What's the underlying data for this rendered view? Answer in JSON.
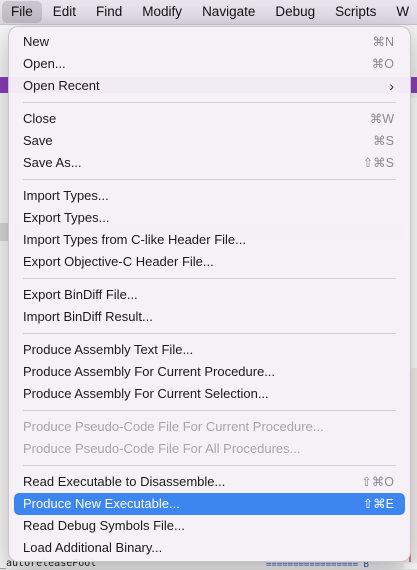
{
  "menubar": {
    "items": [
      "File",
      "Edit",
      "Find",
      "Modify",
      "Navigate",
      "Debug",
      "Scripts",
      "W"
    ]
  },
  "file_menu": {
    "groups": [
      [
        {
          "label": "New",
          "shortcut": "⌘N"
        },
        {
          "label": "Open...",
          "shortcut": "⌘O"
        },
        {
          "label": "Open Recent",
          "shortcut": "›"
        }
      ],
      [
        {
          "label": "Close",
          "shortcut": "⌘W"
        },
        {
          "label": "Save",
          "shortcut": "⌘S"
        },
        {
          "label": "Save As...",
          "shortcut": "⇧⌘S"
        }
      ],
      [
        {
          "label": "Import Types..."
        },
        {
          "label": "Export Types..."
        },
        {
          "label": "Import Types from C-like Header File..."
        },
        {
          "label": "Export Objective-C Header File..."
        }
      ],
      [
        {
          "label": "Export BinDiff File..."
        },
        {
          "label": "Import BinDiff Result..."
        }
      ],
      [
        {
          "label": "Produce Assembly Text File..."
        },
        {
          "label": "Produce Assembly For Current Procedure..."
        },
        {
          "label": "Produce Assembly For Current Selection..."
        }
      ],
      [
        {
          "label": "Produce Pseudo-Code File For Current Procedure...",
          "disabled": true
        },
        {
          "label": "Produce Pseudo-Code File For All Procedures...",
          "disabled": true
        }
      ],
      [
        {
          "label": "Read Executable to Disassemble...",
          "shortcut": "⇧⌘O"
        },
        {
          "label": "Produce New Executable...",
          "shortcut": "⇧⌘E",
          "highlight": true
        },
        {
          "label": "Read Debug Symbols File..."
        },
        {
          "label": "Load Additional Binary..."
        }
      ]
    ]
  },
  "background": {
    "bottom_text": "_autoreleasePool",
    "dash_text": "================= B"
  }
}
